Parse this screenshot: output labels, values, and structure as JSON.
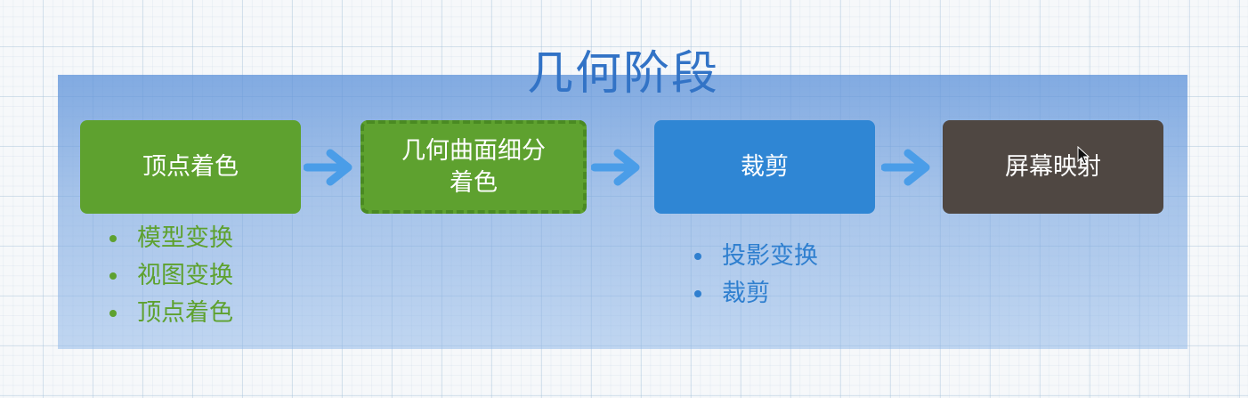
{
  "title": "几何阶段",
  "stages": [
    {
      "label": "顶点着色",
      "color": "#5ea12f",
      "optional": false
    },
    {
      "label": "几何曲面细分着色",
      "color": "#5ea12f",
      "optional": true
    },
    {
      "label": "裁剪",
      "color": "#2f86d4",
      "optional": false
    },
    {
      "label": "屏幕映射",
      "color": "#4f4742",
      "optional": false
    }
  ],
  "vertex_shading_items": [
    "模型变换",
    "视图变换",
    "顶点着色"
  ],
  "clipping_items": [
    "投影变换",
    "裁剪"
  ],
  "arrow_color": "#4a9de8",
  "panel_color": "#6a9fdf"
}
